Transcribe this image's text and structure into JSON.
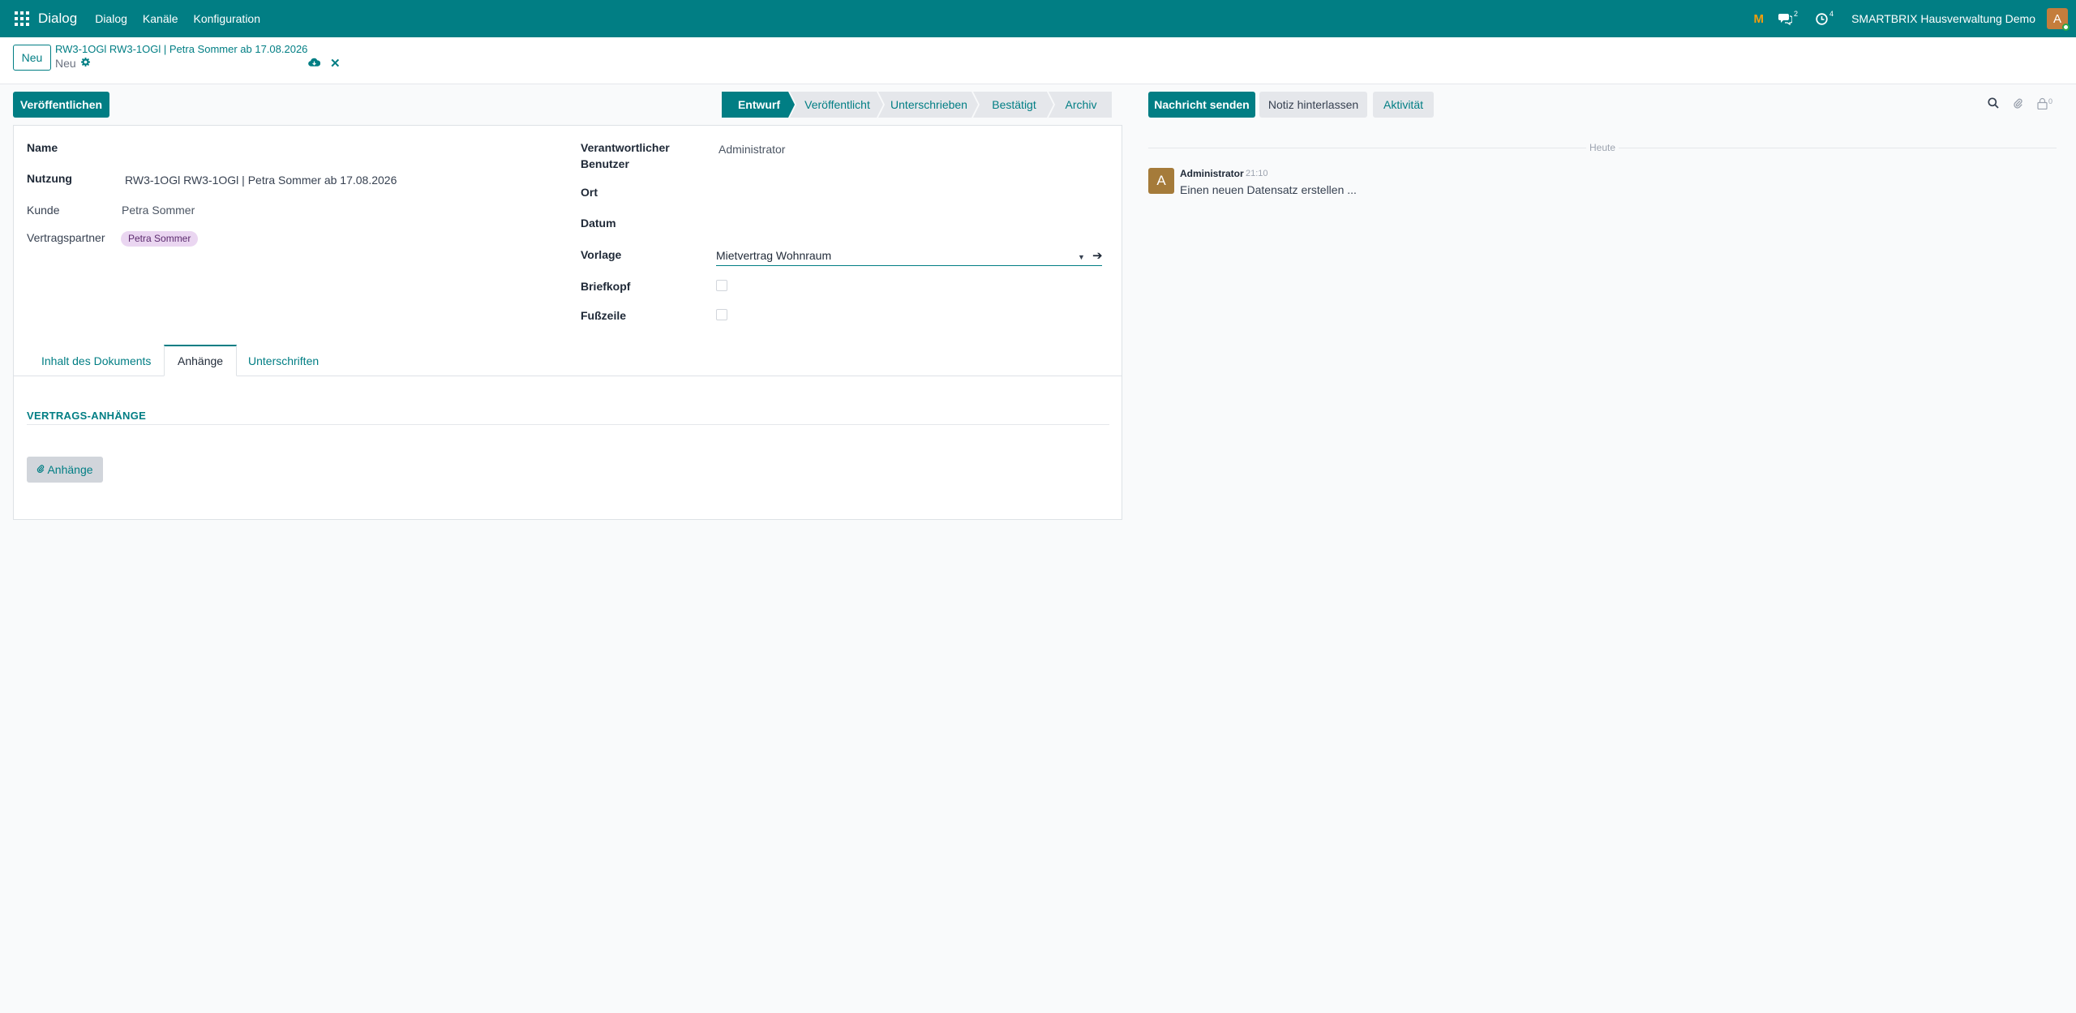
{
  "topbar": {
    "brand": "Dialog",
    "menu": [
      "Dialog",
      "Kanäle",
      "Konfiguration"
    ],
    "m_icon": "M",
    "messages_count": "2",
    "activities_count": "4",
    "company": "SMARTBRIX Hausverwaltung Demo",
    "avatar_letter": "A"
  },
  "control": {
    "new_label": "Neu",
    "breadcrumb": "RW3-1OGl RW3-1OGl | Petra Sommer ab 17.08.2026",
    "record_status": "Neu"
  },
  "actions": {
    "publish_label": "Veröffentlichen",
    "send_message_label": "Nachricht senden",
    "log_note_label": "Notiz hinterlassen",
    "activity_label": "Aktivität"
  },
  "statusbar": [
    "Entwurf",
    "Veröffentlicht",
    "Unterschrieben",
    "Bestätigt",
    "Archiv"
  ],
  "form": {
    "name_label": "Name",
    "nutzung_label": "Nutzung",
    "nutzung_value": "RW3-1OGl RW3-1OGl | Petra Sommer ab 17.08.2026",
    "kunde_label": "Kunde",
    "kunde_value": "Petra Sommer",
    "partner_label": "Vertragspartner",
    "partner_tag": "Petra Sommer",
    "user_label_1": "Verantwortlicher",
    "user_label_2": "Benutzer",
    "user_value": "Administrator",
    "ort_label": "Ort",
    "datum_label": "Datum",
    "vorlage_label": "Vorlage",
    "vorlage_value": "Mietvertrag Wohnraum",
    "briefkopf_label": "Briefkopf",
    "fusszeile_label": "Fußzeile"
  },
  "tabs": [
    "Inhalt des Dokuments",
    "Anhänge",
    "Unterschriften"
  ],
  "attachments": {
    "section_title": "VERTRAGS-ANHÄNGE",
    "button_label": "Anhänge"
  },
  "chatter": {
    "today_label": "Heute",
    "attachment_count": "0",
    "message": {
      "author": "Administrator",
      "time": "21:10",
      "body": "Einen neuen Datensatz erstellen ...",
      "avatar_letter": "A"
    }
  },
  "colors": {
    "primary": "#017e84",
    "tag_bg": "#ead6f1"
  }
}
